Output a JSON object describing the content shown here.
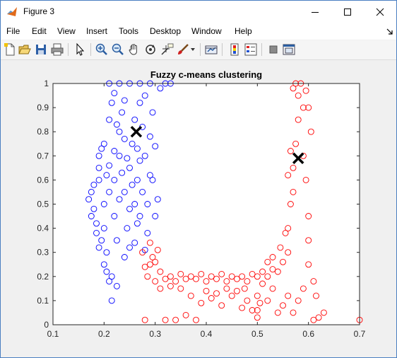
{
  "window": {
    "title": "Figure 3",
    "minimize_icon": "minimize-icon",
    "maximize_icon": "maximize-icon",
    "close_icon": "close-icon",
    "border_color": "#4a7fc1"
  },
  "menu": [
    "File",
    "Edit",
    "View",
    "Insert",
    "Tools",
    "Desktop",
    "Window",
    "Help"
  ],
  "toolbar": {
    "icons": [
      "new-figure-icon",
      "open-file-icon",
      "save-icon",
      "print-icon",
      "pointer-icon",
      "zoom-in-icon",
      "zoom-out-icon",
      "pan-icon",
      "rotate-3d-icon",
      "data-cursor-icon",
      "brush-icon",
      "link-plot-icon",
      "colorbar-icon",
      "legend-icon",
      "hide-plot-tools-icon",
      "show-plot-tools-icon"
    ]
  },
  "chart_data": {
    "type": "scatter",
    "title": "Fuzzy c-means clustering",
    "xlabel": "",
    "ylabel": "",
    "xlim": [
      0.1,
      0.7
    ],
    "ylim": [
      0,
      1
    ],
    "xticks": [
      "0.1",
      "0.2",
      "0.3",
      "0.4",
      "0.5",
      "0.6",
      "0.7"
    ],
    "yticks": [
      "0",
      "0.1",
      "0.2",
      "0.3",
      "0.4",
      "0.5",
      "0.6",
      "0.7",
      "0.8",
      "0.9",
      "1"
    ],
    "grid": false,
    "marker": "open-circle",
    "series": [
      {
        "color": "#0000ff",
        "points": [
          [
            0.17,
            0.52
          ],
          [
            0.175,
            0.55
          ],
          [
            0.18,
            0.48
          ],
          [
            0.175,
            0.45
          ],
          [
            0.18,
            0.58
          ],
          [
            0.185,
            0.42
          ],
          [
            0.19,
            0.6
          ],
          [
            0.185,
            0.38
          ],
          [
            0.19,
            0.65
          ],
          [
            0.195,
            0.35
          ],
          [
            0.19,
            0.7
          ],
          [
            0.195,
            0.73
          ],
          [
            0.19,
            0.32
          ],
          [
            0.2,
            0.25
          ],
          [
            0.205,
            0.22
          ],
          [
            0.21,
            0.18
          ],
          [
            0.215,
            0.2
          ],
          [
            0.225,
            0.16
          ],
          [
            0.2,
            0.75
          ],
          [
            0.2,
            0.5
          ],
          [
            0.2,
            0.4
          ],
          [
            0.205,
            0.3
          ],
          [
            0.21,
            0.55
          ],
          [
            0.21,
            0.85
          ],
          [
            0.215,
            0.92
          ],
          [
            0.22,
            0.96
          ],
          [
            0.22,
            0.6
          ],
          [
            0.22,
            0.45
          ],
          [
            0.225,
            0.35
          ],
          [
            0.23,
            0.7
          ],
          [
            0.23,
            0.8
          ],
          [
            0.235,
            0.88
          ],
          [
            0.24,
            0.93
          ],
          [
            0.24,
            0.55
          ],
          [
            0.245,
            0.4
          ],
          [
            0.25,
            0.32
          ],
          [
            0.25,
            0.65
          ],
          [
            0.255,
            0.75
          ],
          [
            0.26,
            0.85
          ],
          [
            0.265,
            0.6
          ],
          [
            0.27,
            0.45
          ],
          [
            0.27,
            0.92
          ],
          [
            0.275,
            0.55
          ],
          [
            0.28,
            0.7
          ],
          [
            0.285,
            0.38
          ],
          [
            0.29,
            0.78
          ],
          [
            0.29,
            0.62
          ],
          [
            0.295,
            0.88
          ],
          [
            0.3,
            0.45
          ],
          [
            0.3,
            0.74
          ],
          [
            0.305,
            0.52
          ],
          [
            0.31,
            0.98
          ],
          [
            0.32,
            1.0
          ],
          [
            0.33,
            1.0
          ],
          [
            0.21,
            1.0
          ],
          [
            0.23,
            1.0
          ],
          [
            0.25,
            1.0
          ],
          [
            0.27,
            1.0
          ],
          [
            0.29,
            1.0
          ],
          [
            0.215,
            0.1
          ],
          [
            0.24,
            0.28
          ],
          [
            0.26,
            0.34
          ],
          [
            0.28,
            0.31
          ],
          [
            0.25,
            0.48
          ],
          [
            0.23,
            0.52
          ],
          [
            0.27,
            0.68
          ],
          [
            0.26,
            0.5
          ],
          [
            0.22,
            0.72
          ],
          [
            0.24,
            0.77
          ],
          [
            0.255,
            0.58
          ],
          [
            0.265,
            0.42
          ],
          [
            0.235,
            0.63
          ],
          [
            0.285,
            0.5
          ],
          [
            0.295,
            0.6
          ],
          [
            0.21,
            0.66
          ],
          [
            0.205,
            0.62
          ],
          [
            0.275,
            0.82
          ],
          [
            0.28,
            0.95
          ],
          [
            0.225,
            0.83
          ],
          [
            0.245,
            0.69
          ],
          [
            0.265,
            0.73
          ]
        ],
        "centroid": [
          0.263,
          0.8
        ]
      },
      {
        "color": "#ff0000",
        "points": [
          [
            0.275,
            0.3
          ],
          [
            0.28,
            0.24
          ],
          [
            0.285,
            0.2
          ],
          [
            0.29,
            0.34
          ],
          [
            0.3,
            0.26
          ],
          [
            0.3,
            0.18
          ],
          [
            0.31,
            0.22
          ],
          [
            0.32,
            0.19
          ],
          [
            0.33,
            0.2
          ],
          [
            0.34,
            0.18
          ],
          [
            0.35,
            0.21
          ],
          [
            0.36,
            0.19
          ],
          [
            0.37,
            0.2
          ],
          [
            0.38,
            0.19
          ],
          [
            0.39,
            0.21
          ],
          [
            0.4,
            0.18
          ],
          [
            0.41,
            0.2
          ],
          [
            0.42,
            0.19
          ],
          [
            0.43,
            0.21
          ],
          [
            0.44,
            0.18
          ],
          [
            0.45,
            0.2
          ],
          [
            0.46,
            0.19
          ],
          [
            0.47,
            0.2
          ],
          [
            0.48,
            0.18
          ],
          [
            0.49,
            0.21
          ],
          [
            0.5,
            0.2
          ],
          [
            0.51,
            0.22
          ],
          [
            0.52,
            0.2
          ],
          [
            0.53,
            0.23
          ],
          [
            0.54,
            0.22
          ],
          [
            0.55,
            0.26
          ],
          [
            0.56,
            0.3
          ],
          [
            0.56,
            0.4
          ],
          [
            0.565,
            0.5
          ],
          [
            0.57,
            0.55
          ],
          [
            0.57,
            0.65
          ],
          [
            0.575,
            0.75
          ],
          [
            0.58,
            0.85
          ],
          [
            0.58,
            0.95
          ],
          [
            0.585,
            1.0
          ],
          [
            0.575,
            1.0
          ],
          [
            0.57,
            0.98
          ],
          [
            0.59,
            0.9
          ],
          [
            0.59,
            0.7
          ],
          [
            0.595,
            0.6
          ],
          [
            0.6,
            0.45
          ],
          [
            0.6,
            0.35
          ],
          [
            0.6,
            0.25
          ],
          [
            0.59,
            0.15
          ],
          [
            0.58,
            0.1
          ],
          [
            0.57,
            0.05
          ],
          [
            0.56,
            0.12
          ],
          [
            0.55,
            0.08
          ],
          [
            0.54,
            0.05
          ],
          [
            0.53,
            0.15
          ],
          [
            0.52,
            0.1
          ],
          [
            0.5,
            0.03
          ],
          [
            0.5,
            0.06
          ],
          [
            0.48,
            0.1
          ],
          [
            0.47,
            0.07
          ],
          [
            0.45,
            0.12
          ],
          [
            0.43,
            0.08
          ],
          [
            0.42,
            0.13
          ],
          [
            0.4,
            0.14
          ],
          [
            0.38,
            0.02
          ],
          [
            0.36,
            0.04
          ],
          [
            0.34,
            0.02
          ],
          [
            0.32,
            0.02
          ],
          [
            0.28,
            0.02
          ],
          [
            0.61,
            0.02
          ],
          [
            0.62,
            0.03
          ],
          [
            0.63,
            0.05
          ],
          [
            0.7,
            0.02
          ],
          [
            0.615,
            0.12
          ],
          [
            0.61,
            0.18
          ],
          [
            0.605,
            0.8
          ],
          [
            0.6,
            0.9
          ],
          [
            0.595,
            0.97
          ],
          [
            0.565,
            0.72
          ],
          [
            0.56,
            0.62
          ],
          [
            0.555,
            0.38
          ],
          [
            0.545,
            0.32
          ],
          [
            0.53,
            0.28
          ],
          [
            0.52,
            0.26
          ],
          [
            0.51,
            0.17
          ],
          [
            0.5,
            0.12
          ],
          [
            0.505,
            0.09
          ],
          [
            0.49,
            0.06
          ],
          [
            0.475,
            0.15
          ],
          [
            0.46,
            0.14
          ],
          [
            0.44,
            0.15
          ],
          [
            0.41,
            0.11
          ],
          [
            0.39,
            0.09
          ],
          [
            0.37,
            0.12
          ],
          [
            0.35,
            0.15
          ],
          [
            0.33,
            0.16
          ],
          [
            0.31,
            0.15
          ],
          [
            0.295,
            0.28
          ],
          [
            0.29,
            0.25
          ],
          [
            0.305,
            0.31
          ]
        ],
        "centroid": [
          0.58,
          0.69
        ]
      }
    ]
  }
}
